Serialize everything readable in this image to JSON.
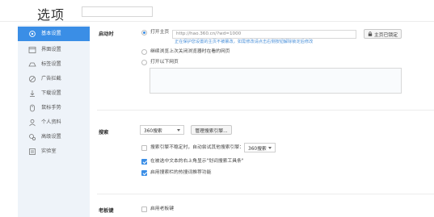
{
  "header": {
    "title": "选项",
    "search": {
      "value": "",
      "placeholder": ""
    }
  },
  "sidebar": {
    "items": [
      {
        "label": "基本设置",
        "icon": "gear-icon",
        "active": true
      },
      {
        "label": "界面设置",
        "icon": "window-icon",
        "active": false
      },
      {
        "label": "标签设置",
        "icon": "tag-icon",
        "active": false
      },
      {
        "label": "广告拦截",
        "icon": "block-icon",
        "active": false
      },
      {
        "label": "下载设置",
        "icon": "download-icon",
        "active": false
      },
      {
        "label": "鼠标手势",
        "icon": "mouse-icon",
        "active": false
      },
      {
        "label": "个人资料",
        "icon": "person-icon",
        "active": false
      },
      {
        "label": "高级设置",
        "icon": "advanced-icon",
        "active": false
      },
      {
        "label": "实验室",
        "icon": "lab-icon",
        "active": false
      }
    ]
  },
  "startup": {
    "label": "启动时",
    "option_homepage": "打开主页",
    "homepage_url": "http://hao.360.cn/?wd=1000",
    "lock_button": "主页已锁定",
    "protect_note": "正在保护您设置的主页不被篡改，如需修改请点击右侧按钮解除锁定后修改",
    "option_continue": "继续浏览上次关闭浏览器时在看的网页",
    "option_pages": "打开以下网页"
  },
  "search": {
    "label": "搜索",
    "engine": "360搜索",
    "manage_button": "管理搜索引擎...",
    "check_auto_switch": "搜索引擎不稳定时，自动尝试其他搜索引擎：",
    "fallback_engine": "360搜索",
    "check_toolbar": "在被选中文本的右上角显示\"划词搜索工具条\"",
    "check_hot": "启用搜索栏的热搜词推荐功能"
  },
  "boss_key": {
    "label": "老板键",
    "check_enable": "启用老板键"
  },
  "colors": {
    "accent": "#3a8ee6",
    "sidebar_bg": "#eef3f9",
    "note": "#4a90d9"
  }
}
